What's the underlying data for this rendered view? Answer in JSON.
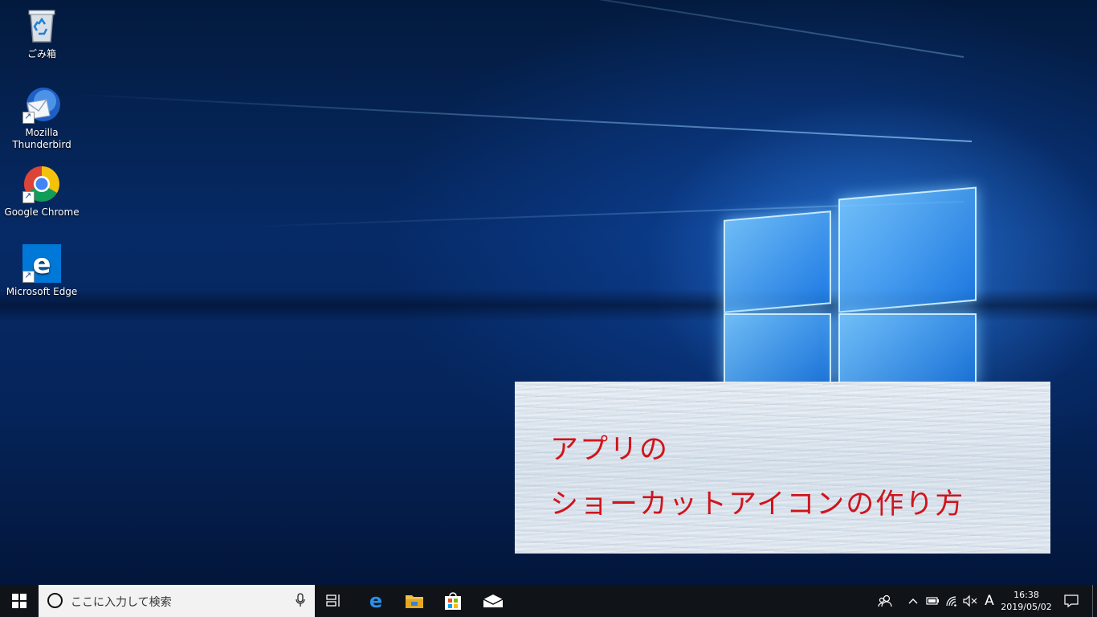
{
  "desktop": {
    "icons": [
      {
        "label": "ごみ箱",
        "icon": "recycle-bin-icon"
      },
      {
        "label": "Mozilla Thunderbird",
        "icon": "thunderbird-icon"
      },
      {
        "label": "Google Chrome",
        "icon": "chrome-icon"
      },
      {
        "label": "Microsoft Edge",
        "icon": "edge-icon"
      }
    ]
  },
  "banner": {
    "line1": "アプリの",
    "line2": "ショーカットアイコンの作り方",
    "text_color": "#d0141b"
  },
  "taskbar": {
    "search_placeholder": "ここに入力して検索",
    "pinned": [
      "task-view-icon",
      "edge-icon",
      "file-explorer-icon",
      "store-icon",
      "mail-icon"
    ],
    "ime_indicator": "A",
    "time": "16:38",
    "date": "2019/05/02"
  },
  "colors": {
    "taskbar": "#101418",
    "accent": "#0078d7"
  }
}
